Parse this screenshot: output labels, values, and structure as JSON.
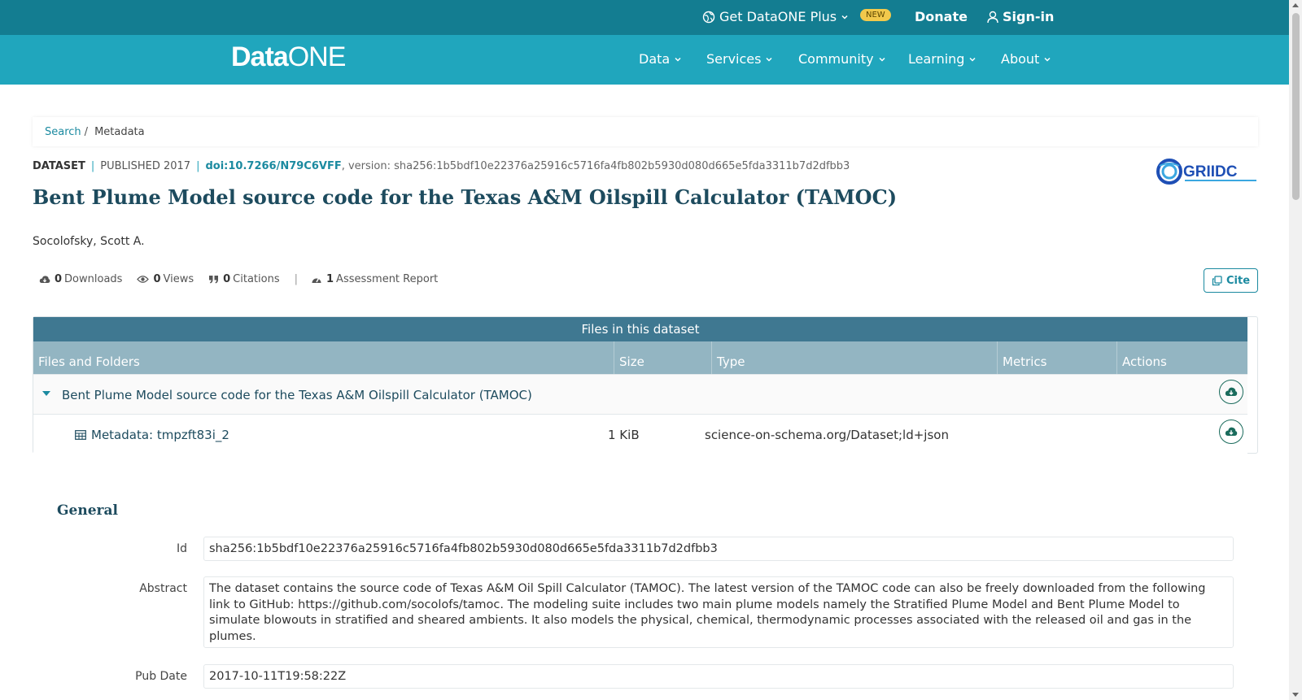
{
  "topbar": {
    "plus_label": "Get DataONE Plus",
    "new_badge": "NEW",
    "donate_label": "Donate",
    "signin_label": "Sign-in"
  },
  "nav": {
    "logo_data": "Data",
    "logo_one": "ONE",
    "items": [
      {
        "label": "Data"
      },
      {
        "label": "Services"
      },
      {
        "label": "Community"
      },
      {
        "label": "Learning"
      },
      {
        "label": "About"
      }
    ]
  },
  "breadcrumb": {
    "search": "Search",
    "separator": "/",
    "current": "Metadata"
  },
  "dataset": {
    "type_label": "DATASET",
    "published": "PUBLISHED 2017",
    "doi": "doi:10.7266/N79C6VFF",
    "version": ", version: sha256:1b5bdf10e22376a25916c5716fa4fb802b5930d080d665e5fda3311b7d2dfbb3",
    "title": "Bent Plume Model source code for the Texas A&M Oilspill Calculator (TAMOC)",
    "author": "Socolofsky, Scott A.",
    "repository_logo_text": "GRIIDC"
  },
  "metrics": {
    "downloads_count": "0",
    "downloads_label": "Downloads",
    "views_count": "0",
    "views_label": "Views",
    "citations_count": "0",
    "citations_label": "Citations",
    "divider": "|",
    "assessment_count": "1",
    "assessment_label": "Assessment Report",
    "cite_label": "Cite"
  },
  "files": {
    "caption": "Files in this dataset",
    "columns": [
      "Files and Folders",
      "Size",
      "Type",
      "Metrics",
      "Actions"
    ],
    "package_title": "Bent Plume Model source code for the Texas A&M Oilspill Calculator (TAMOC)",
    "rows": [
      {
        "name": "Metadata: tmpzft83i_2",
        "size": "1 KiB",
        "type": "science-on-schema.org/Dataset;ld+json"
      }
    ]
  },
  "general": {
    "heading": "General",
    "id_label": "Id",
    "id_value": "sha256:1b5bdf10e22376a25916c5716fa4fb802b5930d080d665e5fda3311b7d2dfbb3",
    "abstract_label": "Abstract",
    "abstract_value": "The dataset contains the source code of Texas A&M Oil Spill Calculator (TAMOC). The latest version of the TAMOC code can also be freely downloaded from the following link to GitHub: https://github.com/socolofs/tamoc. The modeling suite includes two main plume models namely the Stratified Plume Model and Bent Plume Model to simulate blowouts in stratified and sheared ambients. It also models the physical, chemical, thermodynamic processes associated with the released oil and gas in the plumes.",
    "pubdate_label": "Pub Date",
    "pubdate_value": "2017-10-11T19:58:22Z"
  },
  "colors": {
    "topbar": "#137d91",
    "navbar": "#20a6bd",
    "accent": "#1b8aa0",
    "title": "#1d4b5e",
    "table_caption": "#3f7891",
    "table_header": "#93b5c2",
    "badge": "#f2c94c"
  },
  "icons": [
    "globe-icon",
    "chevron-down-icon",
    "user-icon",
    "cloud-download-icon",
    "eye-icon",
    "quote-icon",
    "gauge-icon",
    "copy-icon",
    "table-icon",
    "caret-down-icon"
  ]
}
